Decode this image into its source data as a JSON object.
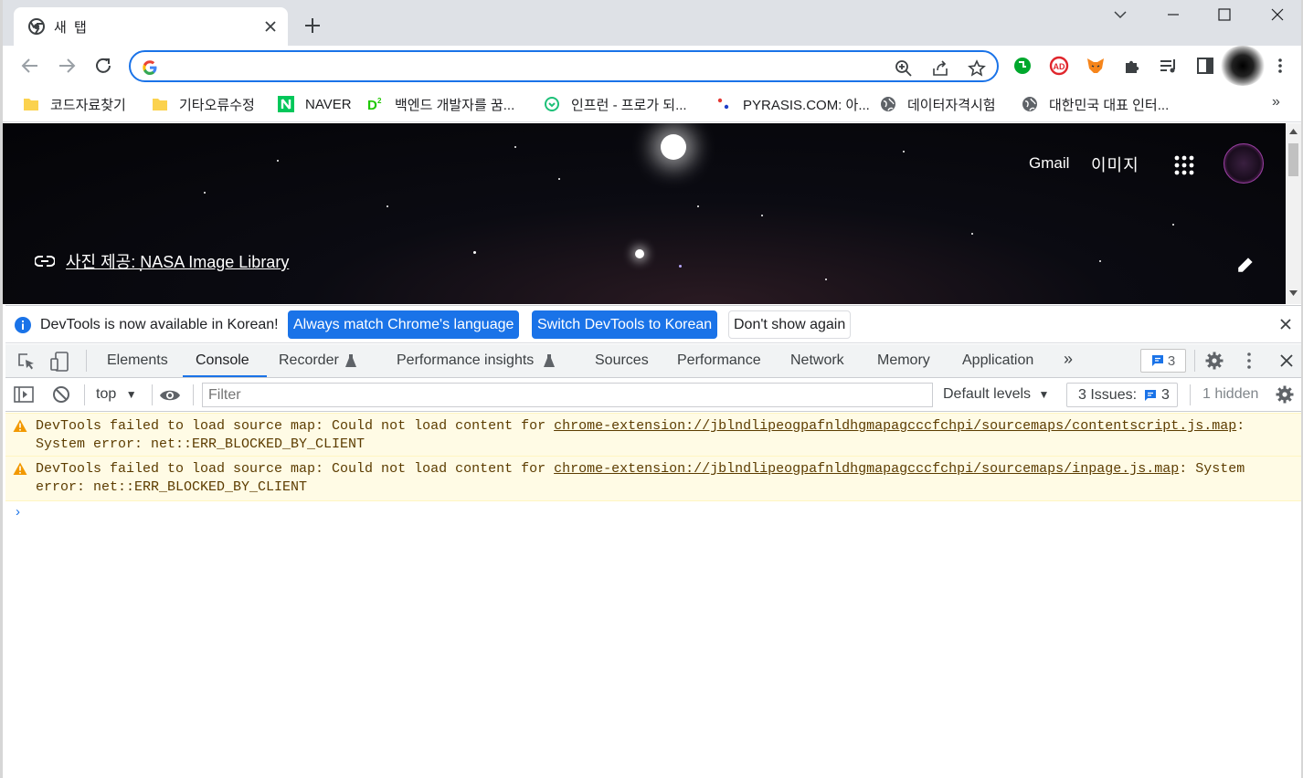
{
  "browser": {
    "tab_title": "새 탭",
    "omnibox_value": "",
    "bookmarks": [
      {
        "label": "코드자료찾기",
        "icon": "folder-icon"
      },
      {
        "label": "기타오류수정",
        "icon": "folder-icon"
      },
      {
        "label": "NAVER",
        "icon": "naver-icon"
      },
      {
        "label": "백엔드 개발자를 꿈...",
        "icon": "d2-icon"
      },
      {
        "label": "인프런 - 프로가 되...",
        "icon": "inflearn-icon"
      },
      {
        "label": "PYRASIS.COM: 아...",
        "icon": "pyrasis-icon"
      },
      {
        "label": "데이터자격시험",
        "icon": "globe-icon"
      },
      {
        "label": "대한민국 대표 인터...",
        "icon": "globe-icon"
      }
    ],
    "bookmarks_more": "»"
  },
  "page": {
    "gmail": "Gmail",
    "images": "이미지",
    "credit": "사진 제공: NASA Image Library"
  },
  "devtools": {
    "infobar": {
      "message": "DevTools is now available in Korean!",
      "btn_match": "Always match Chrome's language",
      "btn_switch": "Switch DevTools to Korean",
      "btn_dont_show": "Don't show again"
    },
    "tabs": [
      "Elements",
      "Console",
      "Recorder",
      "Performance insights",
      "Sources",
      "Performance",
      "Network",
      "Memory",
      "Application"
    ],
    "active_tab": "Console",
    "more_tabs": "»",
    "message_count": "3",
    "console": {
      "context": "top",
      "filter_placeholder": "Filter",
      "levels": "Default levels",
      "issues_label": "3 Issues:",
      "issues_count": "3",
      "hidden": "1 hidden",
      "messages": [
        {
          "prefix": "DevTools failed to load source map: Could not load content for ",
          "link": "chrome-extension://jblndlipeogpafnldhgmapagcccfchpi/sourcemaps/contentscript.js.map",
          "suffix": ": System error: net::ERR_BLOCKED_BY_CLIENT"
        },
        {
          "prefix": "DevTools failed to load source map: Could not load content for ",
          "link": "chrome-extension://jblndlipeogpafnldhgmapagcccfchpi/sourcemaps/inpage.js.map",
          "suffix": ": System error: net::ERR_BLOCKED_BY_CLIENT"
        }
      ],
      "prompt": "›"
    }
  },
  "colors": {
    "accent": "#1a73e8",
    "warning_bg": "#fffbe5",
    "warning_text": "#5c3c00"
  }
}
